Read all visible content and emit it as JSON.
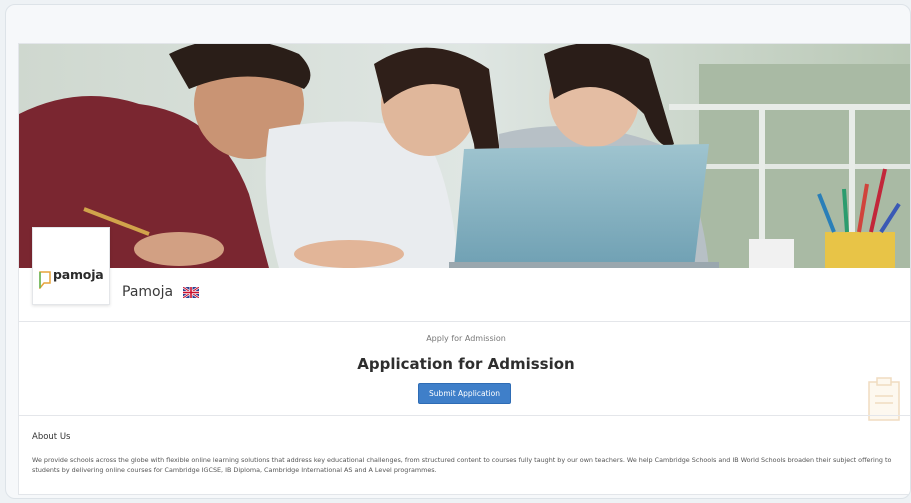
{
  "organization": {
    "logo_text": "pamoja",
    "name": "Pamoja",
    "flag_icon": "uk-flag-icon"
  },
  "admission": {
    "subtitle": "Apply for Admission",
    "title": "Application for Admission",
    "submit_label": "Submit Application"
  },
  "about": {
    "heading": "About Us",
    "body": "We provide schools across the globe with flexible online learning solutions that address key educational challenges, from structured content to courses fully taught by our own teachers. We help Cambridge Schools and IB World Schools broaden their subject offering to students by delivering online courses for Cambridge IGCSE, IB Diploma, Cambridge International AS and A Level programmes."
  },
  "colors": {
    "button": "#3f7fc9",
    "page_background": "#eef2f5"
  }
}
